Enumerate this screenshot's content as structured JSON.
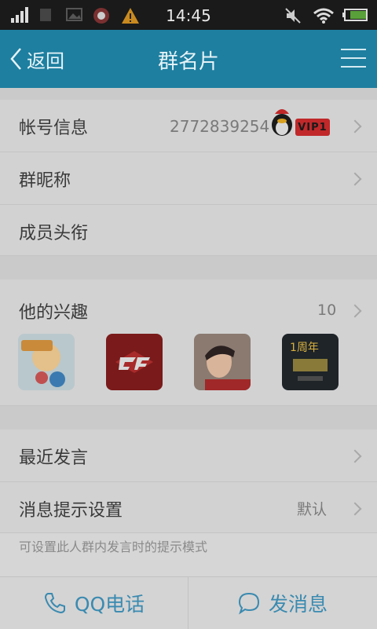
{
  "status_bar": {
    "time": "14:45"
  },
  "nav": {
    "back_label": "返回",
    "title": "群名片"
  },
  "account": {
    "label": "帐号信息",
    "number": "2772839254",
    "vip_badge": "VIP1"
  },
  "group_nickname": {
    "label": "群昵称"
  },
  "member_title": {
    "label": "成员头衔"
  },
  "interests": {
    "label": "他的兴趣",
    "count": "10",
    "items": [
      {
        "icon": "game-app-icon"
      },
      {
        "icon": "crossfire-app-icon"
      },
      {
        "icon": "portrait-photo"
      },
      {
        "icon": "anniversary-game-icon",
        "text": "1周年"
      }
    ]
  },
  "recent_posts": {
    "label": "最近发言"
  },
  "notification": {
    "label": "消息提示设置",
    "value": "默认",
    "hint": "可设置此人群内发言时的提示模式"
  },
  "bottom": {
    "call_label": "QQ电话",
    "message_label": "发消息"
  },
  "colors": {
    "nav_bg": "#1e7fa0",
    "accent": "#3a8ab0",
    "vip_red": "#c0282a"
  }
}
